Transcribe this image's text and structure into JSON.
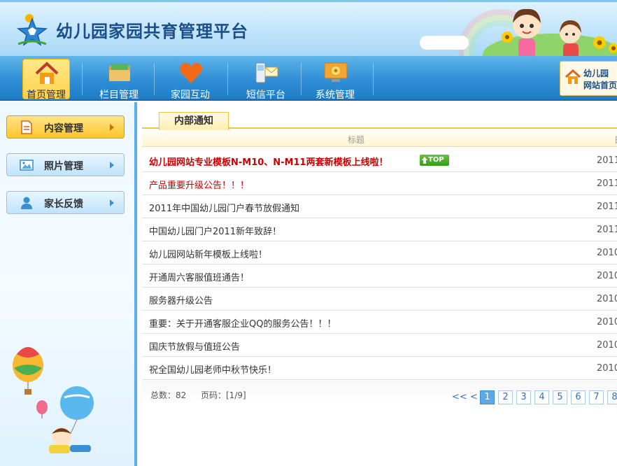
{
  "header": {
    "site_title": "幼儿园家园共育管理平台"
  },
  "nav": {
    "items": [
      {
        "label": "首页管理",
        "icon": "home-icon",
        "active": true
      },
      {
        "label": "栏目管理",
        "icon": "folder-icon",
        "active": false
      },
      {
        "label": "家园互动",
        "icon": "heart-icon",
        "active": false
      },
      {
        "label": "短信平台",
        "icon": "phone-message-icon",
        "active": false
      },
      {
        "label": "系统管理",
        "icon": "monitor-gear-icon",
        "active": false
      }
    ],
    "home_link": {
      "line1": "幼儿园",
      "line2": "网站首页"
    }
  },
  "sidebar": {
    "items": [
      {
        "label": "内容管理",
        "icon": "document-icon",
        "active": true
      },
      {
        "label": "照片管理",
        "icon": "image-icon",
        "active": false
      },
      {
        "label": "家长反馈",
        "icon": "user-icon",
        "active": false
      }
    ]
  },
  "main": {
    "tab_label": "内部通知",
    "columns": {
      "title": "标题",
      "date": "日"
    },
    "rows": [
      {
        "title": "幼儿园网站专业模板N-M10、N-M11两套新模板上线啦！",
        "date": "2011",
        "hot": true,
        "bold": true,
        "badge": "TOP"
      },
      {
        "title": "产品重要升级公告！！！",
        "date": "2011",
        "hot": true,
        "bold": false
      },
      {
        "title": "2011年中国幼儿园门户春节放假通知",
        "date": "2011",
        "hot": false,
        "bold": false
      },
      {
        "title": "中国幼儿园门户2011新年致辞！",
        "date": "2011",
        "hot": false,
        "bold": false
      },
      {
        "title": "幼儿园网站新年模板上线啦！",
        "date": "2010",
        "hot": false,
        "bold": false
      },
      {
        "title": "开通周六客服值班通告！",
        "date": "2010",
        "hot": false,
        "bold": false
      },
      {
        "title": "服务器升级公告",
        "date": "2010",
        "hot": false,
        "bold": false
      },
      {
        "title": "重要：关于开通客服企业QQ的服务公告！！！",
        "date": "2010",
        "hot": false,
        "bold": false
      },
      {
        "title": "国庆节放假与值班公告",
        "date": "2010",
        "hot": false,
        "bold": false
      },
      {
        "title": "祝全国幼儿园老师中秋节快乐！",
        "date": "2010",
        "hot": false,
        "bold": false
      }
    ],
    "pager": {
      "total": "总数：82",
      "page_info": "页码：[1/9]",
      "first": "<<",
      "prev": "<",
      "pages": [
        "1",
        "2",
        "3",
        "4",
        "5",
        "6",
        "7",
        "8"
      ],
      "current": "1"
    }
  },
  "colors": {
    "accent_blue": "#2f8fd6",
    "active_yellow": "#ffd14a",
    "hot_red": "#cc0000",
    "top_green": "#3a9a1f"
  }
}
